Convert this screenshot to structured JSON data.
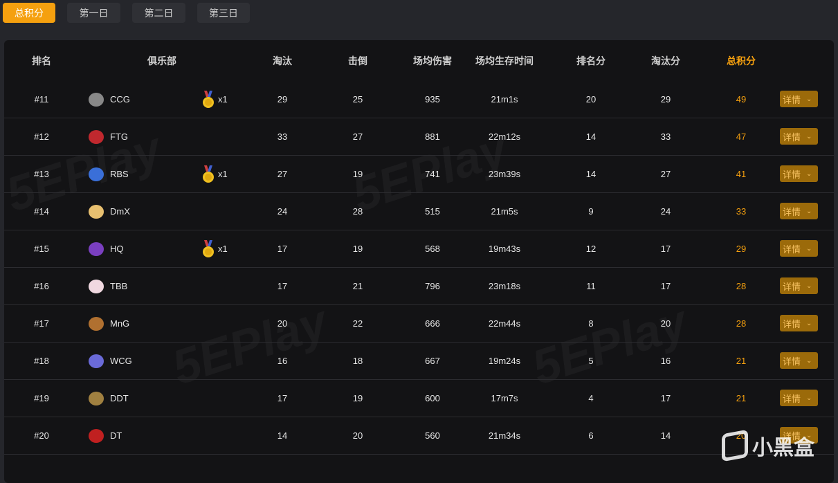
{
  "tabs": [
    {
      "label": "总积分",
      "active": true
    },
    {
      "label": "第一日"
    },
    {
      "label": "第二日"
    },
    {
      "label": "第三日"
    }
  ],
  "columns": [
    "排名",
    "俱乐部",
    "淘汰",
    "击倒",
    "场均伤害",
    "场均生存时间",
    "排名分",
    "淘汰分",
    "总积分"
  ],
  "detail_label": "详情",
  "accent": "#f5a00f",
  "rows": [
    {
      "rank": "#11",
      "club": "CCG",
      "medal": "x1",
      "elim": "29",
      "knock": "25",
      "dmg": "935",
      "surv": "21m1s",
      "rankpts": "20",
      "elimpts": "29",
      "total": "49",
      "logo_color": "#888"
    },
    {
      "rank": "#12",
      "club": "FTG",
      "medal": "",
      "elim": "33",
      "knock": "27",
      "dmg": "881",
      "surv": "22m12s",
      "rankpts": "14",
      "elimpts": "33",
      "total": "47",
      "logo_color": "#c0282e"
    },
    {
      "rank": "#13",
      "club": "RBS",
      "medal": "x1",
      "elim": "27",
      "knock": "19",
      "dmg": "741",
      "surv": "23m39s",
      "rankpts": "14",
      "elimpts": "27",
      "total": "41",
      "logo_color": "#3a6fd8"
    },
    {
      "rank": "#14",
      "club": "DmX",
      "medal": "",
      "elim": "24",
      "knock": "28",
      "dmg": "515",
      "surv": "21m5s",
      "rankpts": "9",
      "elimpts": "24",
      "total": "33",
      "logo_color": "#e8c070"
    },
    {
      "rank": "#15",
      "club": "HQ",
      "medal": "x1",
      "elim": "17",
      "knock": "19",
      "dmg": "568",
      "surv": "19m43s",
      "rankpts": "12",
      "elimpts": "17",
      "total": "29",
      "logo_color": "#7a3fc0"
    },
    {
      "rank": "#16",
      "club": "TBB",
      "medal": "",
      "elim": "17",
      "knock": "21",
      "dmg": "796",
      "surv": "23m18s",
      "rankpts": "11",
      "elimpts": "17",
      "total": "28",
      "logo_color": "#f0d8e0"
    },
    {
      "rank": "#17",
      "club": "MnG",
      "medal": "",
      "elim": "20",
      "knock": "22",
      "dmg": "666",
      "surv": "22m44s",
      "rankpts": "8",
      "elimpts": "20",
      "total": "28",
      "logo_color": "#b07030"
    },
    {
      "rank": "#18",
      "club": "WCG",
      "medal": "",
      "elim": "16",
      "knock": "18",
      "dmg": "667",
      "surv": "19m24s",
      "rankpts": "5",
      "elimpts": "16",
      "total": "21",
      "logo_color": "#6a6ad8"
    },
    {
      "rank": "#19",
      "club": "DDT",
      "medal": "",
      "elim": "17",
      "knock": "19",
      "dmg": "600",
      "surv": "17m7s",
      "rankpts": "4",
      "elimpts": "17",
      "total": "21",
      "logo_color": "#a08040"
    },
    {
      "rank": "#20",
      "club": "DT",
      "medal": "",
      "elim": "14",
      "knock": "20",
      "dmg": "560",
      "surv": "21m34s",
      "rankpts": "6",
      "elimpts": "14",
      "total": "20",
      "logo_color": "#c02020"
    }
  ],
  "watermark": "5EPlay",
  "brand": "小黑盒"
}
